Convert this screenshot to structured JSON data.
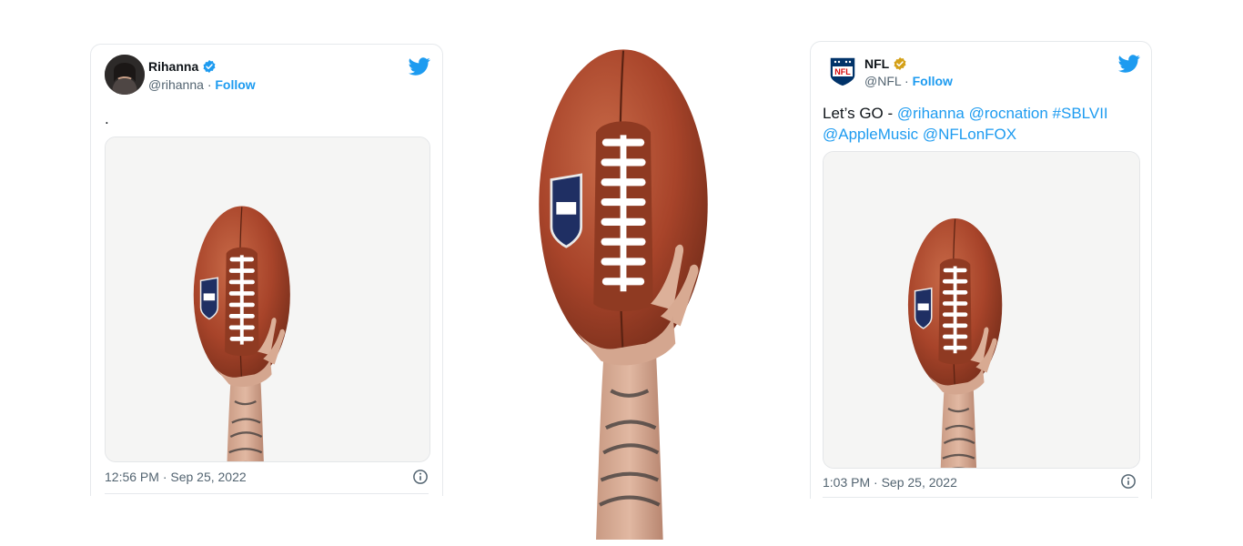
{
  "tweets": [
    {
      "name": "Rihanna",
      "handle": "@rihanna",
      "separator": "·",
      "follow_label": "Follow",
      "text": ".",
      "timestamp": "12:56 PM · Sep 25, 2022",
      "verified_color": "#1d9bf0",
      "icons": [
        "verified-badge-icon",
        "twitter-bird-icon",
        "info-icon"
      ]
    },
    {
      "name": "NFL",
      "handle": "@NFL",
      "separator": "·",
      "follow_label": "Follow",
      "text_prefix": "Let’s GO - ",
      "mentions": [
        "@rihanna",
        "@rocnation",
        "#SBLVII",
        "@AppleMusic",
        "@NFLonFOX"
      ],
      "timestamp": "1:03 PM · Sep 25, 2022",
      "verified_color": "#d4a017",
      "icons": [
        "verified-badge-icon",
        "twitter-bird-icon",
        "info-icon"
      ]
    }
  ],
  "colors": {
    "link": "#1d9bf0",
    "football": "#a8442a",
    "text": "#0f1419",
    "muted": "#536471"
  }
}
